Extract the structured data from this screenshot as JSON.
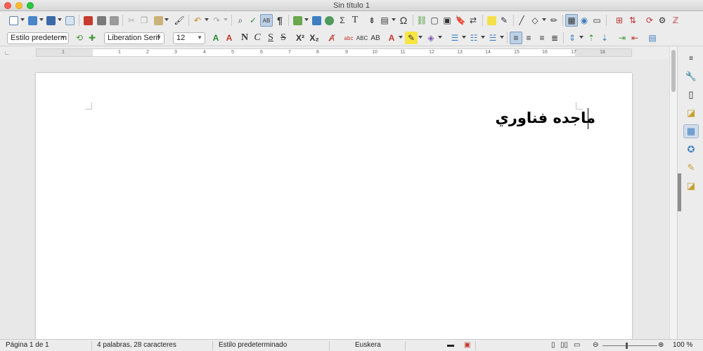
{
  "window": {
    "title": "Sin título 1"
  },
  "toolbar": {
    "paragraph_style": "Estilo predeterm",
    "font_name": "Liberation Serif",
    "font_size": "12",
    "bold_label": "N",
    "italic_label": "C",
    "underline_label": "S",
    "strike_label": "S",
    "superscript_label": "X²",
    "subscript_label": "X₂",
    "pilcrow": "¶",
    "omega": "Ω"
  },
  "ruler": {
    "numbers": [
      "1",
      "1",
      "2",
      "3",
      "4",
      "5",
      "6",
      "7",
      "8",
      "9",
      "10",
      "11",
      "12",
      "13",
      "14",
      "15",
      "16",
      "17",
      "18"
    ]
  },
  "document": {
    "text": "ماجده فناوري"
  },
  "statusbar": {
    "page": "Página 1 de 1",
    "word_count": "4 palabras, 28 caracteres",
    "page_style": "Estilo predeterminado",
    "language": "Euskera",
    "zoom": "100 %"
  },
  "colors": {
    "accent": "#bcd0e6",
    "page": "#ffffff",
    "workspace": "#e8e8e8"
  }
}
